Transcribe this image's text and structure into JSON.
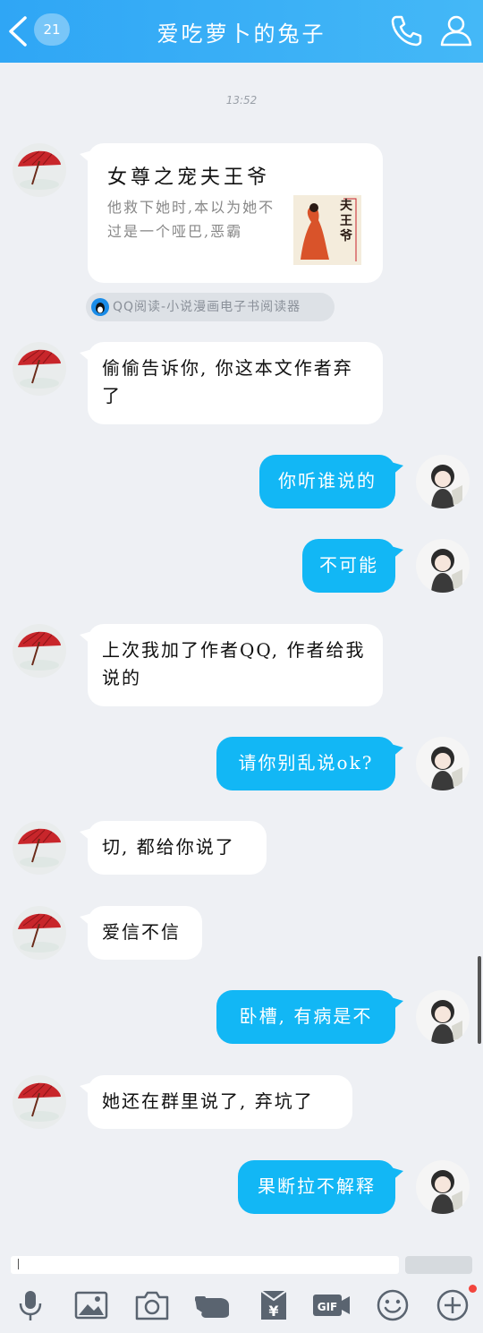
{
  "header": {
    "back_badge": "21",
    "title": "爱吃萝卜的兔子"
  },
  "timestamp": "13:52",
  "card": {
    "title": "女尊之宠夫王爷",
    "description": "他救下她时,本以为她不过是一个哑巴,恶霸",
    "cover_text": "夫王爷",
    "source": "QQ阅读-小说漫画电子书阅读器"
  },
  "messages": [
    {
      "side": "in",
      "text": "偷偷告诉你, 你这本文作者弃了"
    },
    {
      "side": "out",
      "text": "你听谁说的"
    },
    {
      "side": "out",
      "text": "不可能"
    },
    {
      "side": "in",
      "text": "上次我加了作者QQ, 作者给我说的"
    },
    {
      "side": "out",
      "text": "请你别乱说ok?"
    },
    {
      "side": "in",
      "text": "切, 都给你说了"
    },
    {
      "side": "in",
      "text": "爱信不信"
    },
    {
      "side": "out",
      "text": "卧槽, 有病是不"
    },
    {
      "side": "in",
      "text": "她还在群里说了, 弃坑了"
    },
    {
      "side": "out",
      "text": "果断拉不解释"
    }
  ],
  "toolbar": {
    "icons": [
      "microphone-icon",
      "image-icon",
      "camera-icon",
      "hongbao-icon",
      "money-icon",
      "gif-icon",
      "emoji-icon",
      "plus-icon"
    ],
    "gif_label": "GIF",
    "money_label": "¥",
    "has_notification_dot": true
  },
  "colors": {
    "header": "#2fa6f5",
    "outgoing_bubble": "#12b7f5",
    "incoming_bubble": "#ffffff",
    "background": "#eef0f4",
    "notification": "#f2453d"
  }
}
